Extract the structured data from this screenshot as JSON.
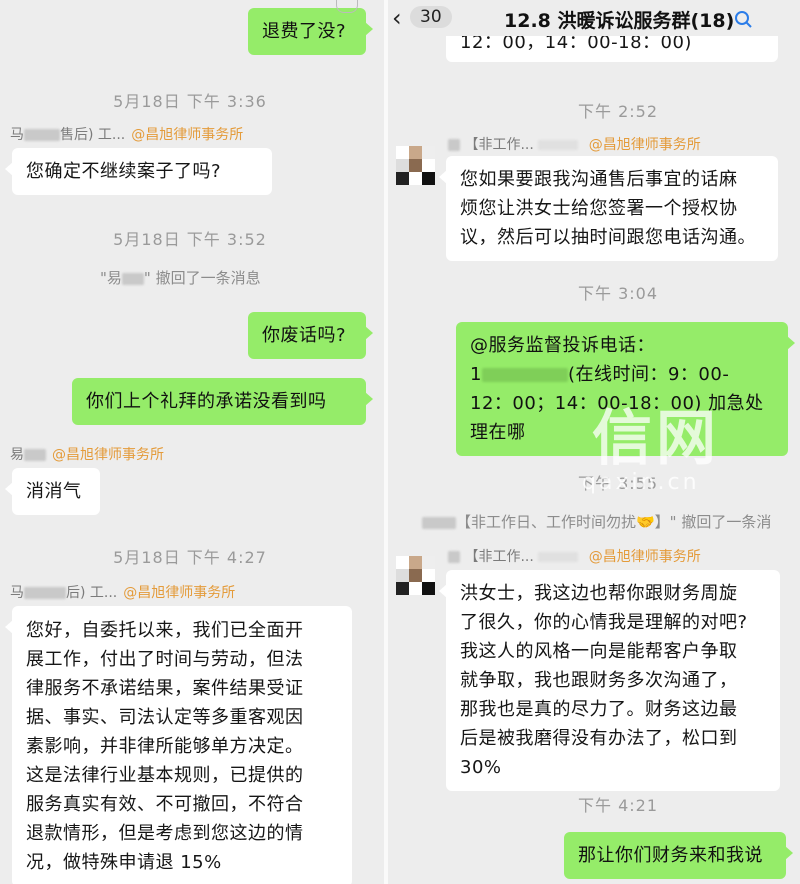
{
  "left": {
    "msg_refund": "退费了没?",
    "time1": "5月18日 下午 3:36",
    "sender1": {
      "name_a": "马",
      "name_b": "售后) 工...",
      "firm": "@昌旭律师事务所"
    },
    "msg_continue": "您确定不继续案子了吗?",
    "time2": "5月18日 下午 3:52",
    "recall_name": "\"易",
    "recall_text": "\" 撤回了一条消息",
    "msg_nonsense": "你废话吗?",
    "msg_promise": "你们上个礼拜的承诺没看到吗",
    "sender2": {
      "name_a": "易",
      "firm": "@昌旭律师事务所"
    },
    "msg_calm": "消消气",
    "time3": "5月18日 下午 4:27",
    "sender3": {
      "name_a": "马",
      "name_b": "后) 工...",
      "firm": "@昌旭律师事务所"
    },
    "msg_long": [
      "您好，自委托以来，我们已全面开",
      "展工作，付出了时间与劳动，但法",
      "律服务不承诺结果，案件结果受证",
      "据、事实、司法认定等多重客观因",
      "素影响，并非律所能够单方决定。",
      "这是法律行业基本规则，已提供的",
      "服务真实有效、不可撤回，不符合",
      "退款情形，但是考虑到您这边的情",
      "况，做特殊申请退 15%"
    ]
  },
  "right": {
    "back_count": "30",
    "title": "12.8 洪暖诉讼服务群(18)",
    "top_partial": "12：00，14：00-18：00)",
    "time1": "下午 2:52",
    "sender1": {
      "tag": "【非工作...",
      "firm": "@昌旭律师事务所"
    },
    "msg_auth": [
      "您如果要跟我沟通售后事宜的话麻",
      "烦您让洪女士给您签署一个授权协",
      "议，然后可以抽时间跟您电话沟通。"
    ],
    "time2": "下午 3:04",
    "msg_complaint": [
      "@服务监督投诉电话：",
      "(在线时间：9：00-",
      "12：00；14：00-18：00) 加急处",
      "理在哪"
    ],
    "complaint_prefix": "1",
    "time3": "下午 3:55",
    "recall_text": "【非工作日、工作时间勿扰🤝】\" 撤回了一条消",
    "sender2": {
      "tag": "【非工作...",
      "firm": "@昌旭律师事务所"
    },
    "msg_finance": [
      "洪女士，我这边也帮你跟财务周旋",
      "了很久，你的心情我是理解的对吧?",
      "我这人的风格一向是能帮客户争取",
      "就争取，我也跟财务多次沟通了，",
      "那我也是真的尽力了。财务这边最",
      "后是被我磨得没有办法了，松口到",
      "30%"
    ],
    "time4": "下午 4:21",
    "msg_finance_come": "那让你们财务来和我说"
  },
  "watermark": {
    "main": "信网",
    "sub": "qaxin.cn"
  },
  "colors": {
    "green_bubble": "#95ec69",
    "white_bubble": "#ffffff",
    "firm_orange": "#e49b3a",
    "background": "#ededed"
  }
}
